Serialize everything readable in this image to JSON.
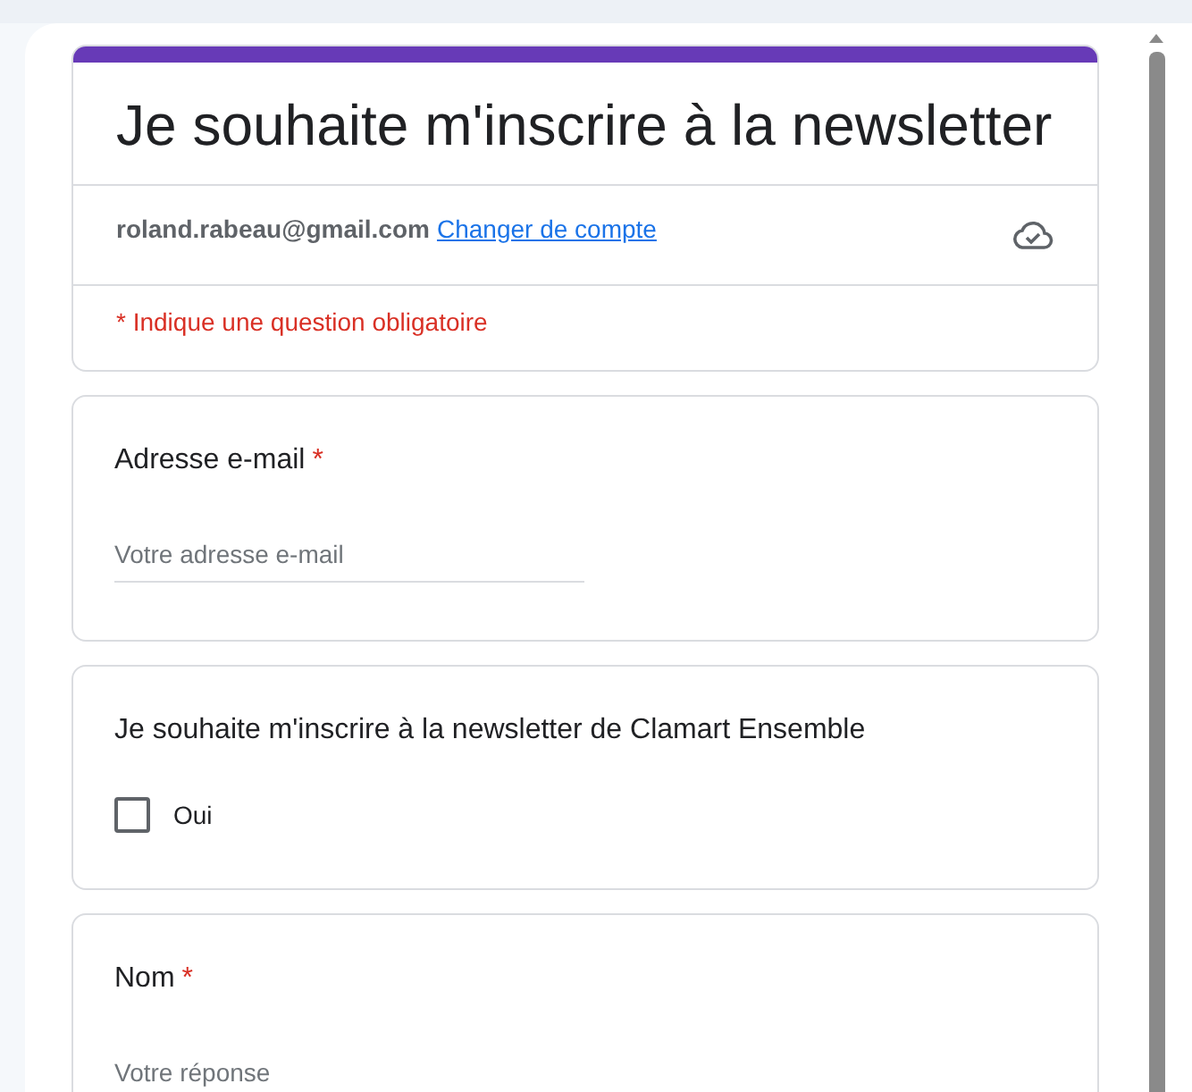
{
  "header": {
    "title": "Je souhaite m'inscrire à la newsletter",
    "account_email": "roland.rabeau@gmail.com",
    "switch_account_link": "Changer de compte",
    "saved": true,
    "required_note": "* Indique une question obligatoire"
  },
  "required_marker": "*",
  "questions": [
    {
      "kind": "text",
      "label": "Adresse e-mail",
      "required": true,
      "placeholder": "Votre adresse e-mail"
    },
    {
      "kind": "checkbox",
      "label": "Je souhaite m'inscrire à la newsletter de Clamart Ensemble",
      "required": false,
      "options": [
        {
          "label": "Oui",
          "checked": false
        }
      ]
    },
    {
      "kind": "text",
      "label": "Nom",
      "required": true,
      "placeholder": "Votre réponse"
    }
  ]
}
